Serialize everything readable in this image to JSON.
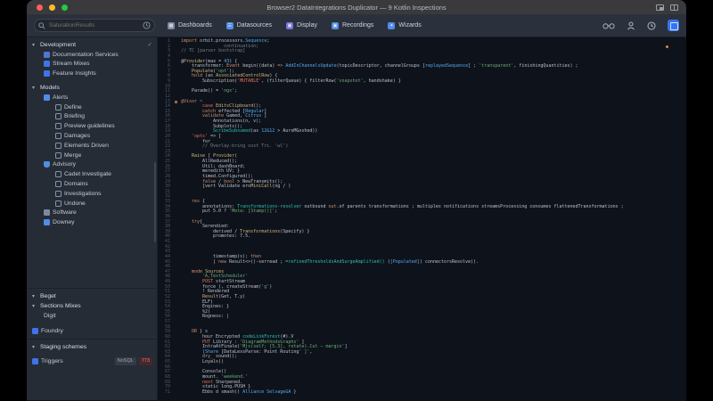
{
  "window": {
    "title": "Browser2  DataIntegrations Duplicator — 9 Kotlin Inspections"
  },
  "toolbar": {
    "search": {
      "placeholder": "SaturationResults"
    },
    "nav": [
      {
        "label": "Dashboards",
        "icon": "dashboards-icon",
        "icon_color": "#7f8aa0",
        "glyph": "▦"
      },
      {
        "label": "Datasources",
        "icon": "datasources-icon",
        "icon_color": "#4f8ee8",
        "glyph": "☰"
      },
      {
        "label": "Display",
        "icon": "display-icon",
        "icon_color": "#7d6fe0",
        "glyph": "▣"
      },
      {
        "label": "Recordings",
        "icon": "recordings-icon",
        "icon_color": "#4f8ee8",
        "glyph": "▣"
      },
      {
        "label": "Wizards",
        "icon": "wizards-icon",
        "icon_color": "#4f8ee8",
        "glyph": "✦"
      }
    ]
  },
  "sidebar": {
    "tree": [
      {
        "label": "Development",
        "ind": 0,
        "chevron": true,
        "section": true,
        "check": true
      },
      {
        "label": "Documentation Services",
        "ind": 1,
        "icon": "doc"
      },
      {
        "label": "Stream Mixes",
        "ind": 1,
        "icon": "db"
      },
      {
        "label": "Feature Insights",
        "ind": 1,
        "icon": "db"
      },
      {
        "label": "Models",
        "ind": 0,
        "chevron": true,
        "section": true,
        "gap": 5
      },
      {
        "label": "Alerts",
        "ind": 1,
        "icon": "folder"
      },
      {
        "label": "Define",
        "ind": 2,
        "icon": "sq"
      },
      {
        "label": "Briefing",
        "ind": 2,
        "icon": "sq"
      },
      {
        "label": "Preview guidelines",
        "ind": 2,
        "icon": "sq"
      },
      {
        "label": "Damages",
        "ind": 2,
        "icon": "sq"
      },
      {
        "label": "Elements Driven",
        "ind": 2,
        "icon": "sq"
      },
      {
        "label": "Merge",
        "ind": 2,
        "icon": "sq"
      },
      {
        "label": "Advisory",
        "ind": 1,
        "icon": "shield"
      },
      {
        "label": "Cadet Investigate",
        "ind": 2,
        "icon": "sq"
      },
      {
        "label": "Domains",
        "ind": 2,
        "icon": "sq"
      },
      {
        "label": "Investigations",
        "ind": 2,
        "icon": "sq"
      },
      {
        "label": "Undone",
        "ind": 2,
        "icon": "sq"
      },
      {
        "label": "Software",
        "ind": 1,
        "icon": "gear"
      },
      {
        "label": "Downey",
        "ind": 1,
        "icon": "dl"
      },
      {
        "label": "Beget",
        "ind": 0,
        "chevron": true,
        "section": true,
        "gap": 72,
        "divider": true
      },
      {
        "label": "Sections Mixes",
        "ind": 0,
        "chevron": true,
        "section": true
      },
      {
        "label": "Digit",
        "ind": 1
      },
      {
        "label": "Foundry",
        "ind": 0,
        "icon": "db",
        "gap": 7
      },
      {
        "label": "Staging schemes",
        "ind": 0,
        "chevron": true,
        "section": true,
        "gap": 7,
        "divider": true
      },
      {
        "label": "Triggers",
        "ind": 0,
        "icon": "db",
        "gap": 5,
        "badges": [
          "NoSQL",
          "773"
        ]
      }
    ]
  },
  "editor": {
    "lines": [
      {
        "ind": 0,
        "seg": [
          [
            "k",
            "import "
          ],
          [
            "p",
            "orbit.processors."
          ],
          [
            "b",
            "Sequence"
          ],
          [
            "p",
            ";"
          ]
        ]
      },
      {
        "ind": 4,
        "seg": [
          [
            "c",
            "continuation;"
          ]
        ]
      },
      {
        "ind": 0,
        "seg": [
          [
            "c",
            "// TC [parser bootstrap]"
          ]
        ]
      },
      {
        "ind": 0,
        "seg": []
      },
      {
        "ind": 0,
        "seg": [
          [
            "p",
            "@"
          ],
          [
            "y",
            "Provider"
          ],
          [
            "p",
            "(max = "
          ],
          [
            "b",
            "43"
          ],
          [
            "p",
            ") {"
          ]
        ]
      },
      {
        "ind": 1,
        "seg": [
          [
            "p",
            "transformer: "
          ],
          [
            "k",
            "Event"
          ],
          [
            "p",
            " begin((data) "
          ],
          [
            "k",
            "=>"
          ],
          [
            "p",
            " "
          ],
          [
            "b",
            "AddInChannelsUpdate"
          ],
          [
            "p",
            "(topicDescriptor, channelGroups ["
          ],
          [
            "b",
            "replayedSequence"
          ],
          [
            "p",
            "] ; "
          ],
          [
            "s",
            "'transparent'"
          ],
          [
            "p",
            ", finishingQuantities) ;"
          ]
        ]
      },
      {
        "ind": 1,
        "seg": [
          [
            "y",
            "Populate"
          ],
          [
            "p",
            "("
          ],
          [
            "s",
            "'opt'"
          ],
          [
            "p",
            ");"
          ]
        ]
      },
      {
        "ind": 1,
        "seg": [
          [
            "k",
            "hold"
          ],
          [
            "p",
            " (as "
          ],
          [
            "y",
            "AssociatedControlRow"
          ],
          [
            "p",
            ") {"
          ]
        ]
      },
      {
        "ind": 2,
        "seg": [
          [
            "p",
            "Subscription("
          ],
          [
            "r",
            "'MUTABLE'"
          ],
          [
            "p",
            ", (filterQueue) { filterRow("
          ],
          [
            "s",
            "'snapshot'"
          ],
          [
            "p",
            ", handshake) }"
          ]
        ]
      },
      {
        "ind": 0,
        "seg": []
      },
      {
        "ind": 1,
        "seg": [
          [
            "p",
            "Parade() = "
          ],
          [
            "s",
            "'ngx'"
          ],
          [
            "p",
            ";"
          ]
        ]
      },
      {
        "ind": 0,
        "seg": []
      },
      {
        "ind": 0,
        "icon": true,
        "seg": [
          [
            "k",
            "@Visor"
          ],
          [
            "p",
            " ~"
          ]
        ]
      },
      {
        "ind": 2,
        "seg": [
          [
            "r",
            "case "
          ],
          [
            "y",
            "EditsClipboard"
          ],
          [
            "p",
            "();"
          ]
        ]
      },
      {
        "ind": 2,
        "seg": [
          [
            "k",
            "catch"
          ],
          [
            "p",
            " effected ["
          ],
          [
            "b",
            "Regular"
          ],
          [
            "p",
            "]"
          ]
        ]
      },
      {
        "ind": 2,
        "seg": [
          [
            "k",
            "validate"
          ],
          [
            "p",
            " Gamed, "
          ],
          [
            "b",
            "Citrus"
          ],
          [
            "p",
            " ]"
          ]
        ]
      },
      {
        "ind": 3,
        "seg": [
          [
            "p",
            "Annotations(n, v);"
          ]
        ]
      },
      {
        "ind": 3,
        "seg": [
          [
            "p",
            "Subplots();"
          ]
        ]
      },
      {
        "ind": 3,
        "seg": [
          [
            "t",
            "ScribeSubsumed"
          ],
          [
            "p",
            "(as "
          ],
          [
            "b",
            "12&12"
          ],
          [
            "p",
            " > AuroMGoshed))"
          ]
        ]
      },
      {
        "ind": 1,
        "seg": [
          [
            "r",
            "'opts'"
          ],
          [
            "p",
            " => ]"
          ]
        ]
      },
      {
        "ind": 2,
        "seg": [
          [
            "p",
            "for_"
          ]
        ]
      },
      {
        "ind": 2,
        "seg": [
          [
            "c",
            "// Overlay-bring cost Tri. 'wl')"
          ]
        ]
      },
      {
        "ind": 0,
        "seg": []
      },
      {
        "ind": 1,
        "seg": [
          [
            "y",
            "Raise"
          ],
          [
            "p",
            " [ "
          ],
          [
            "y",
            "Provider"
          ],
          [
            "p",
            "("
          ]
        ]
      },
      {
        "ind": 2,
        "seg": [
          [
            "p",
            "AllReduced();"
          ]
        ]
      },
      {
        "ind": 2,
        "seg": [
          [
            "p",
            "Util; dashBoard;"
          ]
        ]
      },
      {
        "ind": 2,
        "seg": [
          [
            "p",
            "meredith UV; }"
          ]
        ]
      },
      {
        "ind": 2,
        "seg": [
          [
            "p",
            "timed.Configured();"
          ]
        ]
      },
      {
        "ind": 2,
        "seg": [
          [
            "k",
            "false"
          ],
          [
            "p",
            " / "
          ],
          [
            "k",
            "bool"
          ],
          [
            "p",
            " > NewTransmits();"
          ]
        ]
      },
      {
        "ind": 2,
        "seg": [
          [
            "p",
            "[vert Validate ero"
          ],
          [
            "y",
            "MiniCall"
          ],
          [
            "p",
            "(ng / )"
          ]
        ]
      },
      {
        "ind": 0,
        "seg": []
      },
      {
        "ind": 0,
        "seg": []
      },
      {
        "ind": 1,
        "seg": [
          [
            "k",
            "res"
          ],
          [
            "p",
            " {"
          ]
        ]
      },
      {
        "ind": 2,
        "seg": [
          [
            "p",
            "annotations: "
          ],
          [
            "t",
            "Transformations-resolver"
          ],
          [
            "p",
            " outbound "
          ],
          [
            "k",
            "out"
          ],
          [
            "p",
            ".of parents transformations ; multiples notifications streamsProcessing consumes flattenedTransformations ;"
          ]
        ]
      },
      {
        "ind": 2,
        "seg": [
          [
            "p",
            "put 5.0 ? "
          ],
          [
            "s",
            "'Meta: [Stamp()]'"
          ],
          [
            "p",
            ";"
          ]
        ]
      },
      {
        "ind": 0,
        "seg": []
      },
      {
        "ind": 1,
        "seg": [
          [
            "k",
            "try"
          ],
          [
            "p",
            "{"
          ]
        ]
      },
      {
        "ind": 2,
        "seg": [
          [
            "p",
            "Serendied:"
          ]
        ]
      },
      {
        "ind": 3,
        "seg": [
          [
            "p",
            "derived / "
          ],
          [
            "y",
            "Transformations"
          ],
          [
            "p",
            "(Specify) }"
          ]
        ]
      },
      {
        "ind": 3,
        "seg": [
          [
            "p",
            "promotes: 7.5."
          ]
        ]
      },
      {
        "ind": 0,
        "seg": []
      },
      {
        "ind": 0,
        "seg": []
      },
      {
        "ind": 0,
        "seg": []
      },
      {
        "ind": 3,
        "seg": [
          [
            "p",
            "timestamp(s); "
          ],
          [
            "k",
            "then"
          ]
        ]
      },
      {
        "ind": 3,
        "seg": [
          [
            "p",
            "| "
          ],
          [
            "k",
            "new"
          ],
          [
            "p",
            " Result<>()-serread ; "
          ],
          [
            "t",
            "=refinedThresholdsAndSurgeAmplified()"
          ],
          [
            "p",
            " ("
          ],
          [
            "b",
            "[Populated]"
          ],
          [
            "p",
            ") connectorsResolve()."
          ]
        ]
      },
      {
        "ind": 0,
        "seg": []
      },
      {
        "ind": 1,
        "seg": [
          [
            "k",
            "mode "
          ],
          [
            "y",
            "Sources"
          ]
        ]
      },
      {
        "ind": 2,
        "seg": [
          [
            "s",
            "'A,TextScheduler'"
          ]
        ]
      },
      {
        "ind": 2,
        "seg": [
          [
            "r",
            "POST"
          ],
          [
            "p",
            " startStream"
          ]
        ]
      },
      {
        "ind": 2,
        "seg": [
          [
            "p",
            "force ), createStream("
          ],
          [
            "s",
            "'g'"
          ],
          [
            "p",
            ")"
          ]
        ]
      },
      {
        "ind": 2,
        "seg": [
          [
            "p",
            "! Rendered"
          ]
        ]
      },
      {
        "ind": 2,
        "seg": [
          [
            "y",
            "Result"
          ],
          [
            "p",
            "(Get, T.y)"
          ]
        ]
      },
      {
        "ind": 2,
        "seg": [
          [
            "p",
            "ELF)"
          ]
        ]
      },
      {
        "ind": 2,
        "seg": [
          [
            "p",
            "Engines: }"
          ]
        ]
      },
      {
        "ind": 2,
        "seg": [
          [
            "p",
            "%2("
          ]
        ]
      },
      {
        "ind": 2,
        "seg": [
          [
            "p",
            "Rogness: |"
          ]
        ]
      },
      {
        "ind": 0,
        "seg": []
      },
      {
        "ind": 0,
        "seg": []
      },
      {
        "ind": 1,
        "seg": [
          [
            "k",
            "OR"
          ],
          [
            "p",
            " } s"
          ]
        ]
      },
      {
        "ind": 2,
        "seg": [
          [
            "p",
            "hour Encrypted "
          ],
          [
            "t",
            "codeLinkForest"
          ],
          [
            "p",
            "(#).V"
          ]
        ]
      },
      {
        "ind": 2,
        "seg": [
          [
            "r",
            "PUT"
          ],
          [
            "p",
            " Library : "
          ],
          [
            "s",
            "'DiagramMethodsGraphs'"
          ],
          [
            "p",
            " ]"
          ]
        ]
      },
      {
        "ind": 2,
        "seg": [
          [
            "p",
            "IntraAtFinale("
          ],
          [
            "s",
            "'Mjs(self; [5.3], rotate).Cut — margin'"
          ],
          [
            "p",
            "]"
          ]
        ]
      },
      {
        "ind": 2,
        "seg": [
          [
            "b",
            "[Share"
          ],
          [
            "p",
            " [DataLessParse: Point Routing"
          ],
          [
            "s",
            "' ]'"
          ],
          [
            "p",
            ","
          ]
        ]
      },
      {
        "ind": 2,
        "seg": [
          [
            "k",
            "dry_"
          ],
          [
            "p",
            " sound();"
          ]
        ]
      },
      {
        "ind": 2,
        "seg": [
          [
            "p",
            "Loyals()"
          ]
        ]
      },
      {
        "ind": 0,
        "seg": []
      },
      {
        "ind": 2,
        "seg": [
          [
            "p",
            "Console()"
          ]
        ]
      },
      {
        "ind": 2,
        "seg": [
          [
            "p",
            "mount. "
          ],
          [
            "s",
            "'weekend.'"
          ]
        ]
      },
      {
        "ind": 2,
        "seg": [
          [
            "r",
            "next"
          ],
          [
            "p",
            " Sharpened."
          ]
        ]
      },
      {
        "ind": 2,
        "seg": [
          [
            "p",
            "static long.PUSH }"
          ]
        ]
      },
      {
        "ind": 2,
        "seg": [
          [
            "p",
            "Ebbs d smash() "
          ],
          [
            "b",
            "Alliance SelvageGA"
          ],
          [
            "p",
            " }"
          ]
        ]
      }
    ]
  },
  "colors": {
    "accent_blue": "#3574f0",
    "keyword_orange": "#cf8e6d",
    "string_green": "#6aab73",
    "error_stripe_orange": "#d98a4a",
    "badge_red_text": "#e57d74"
  }
}
